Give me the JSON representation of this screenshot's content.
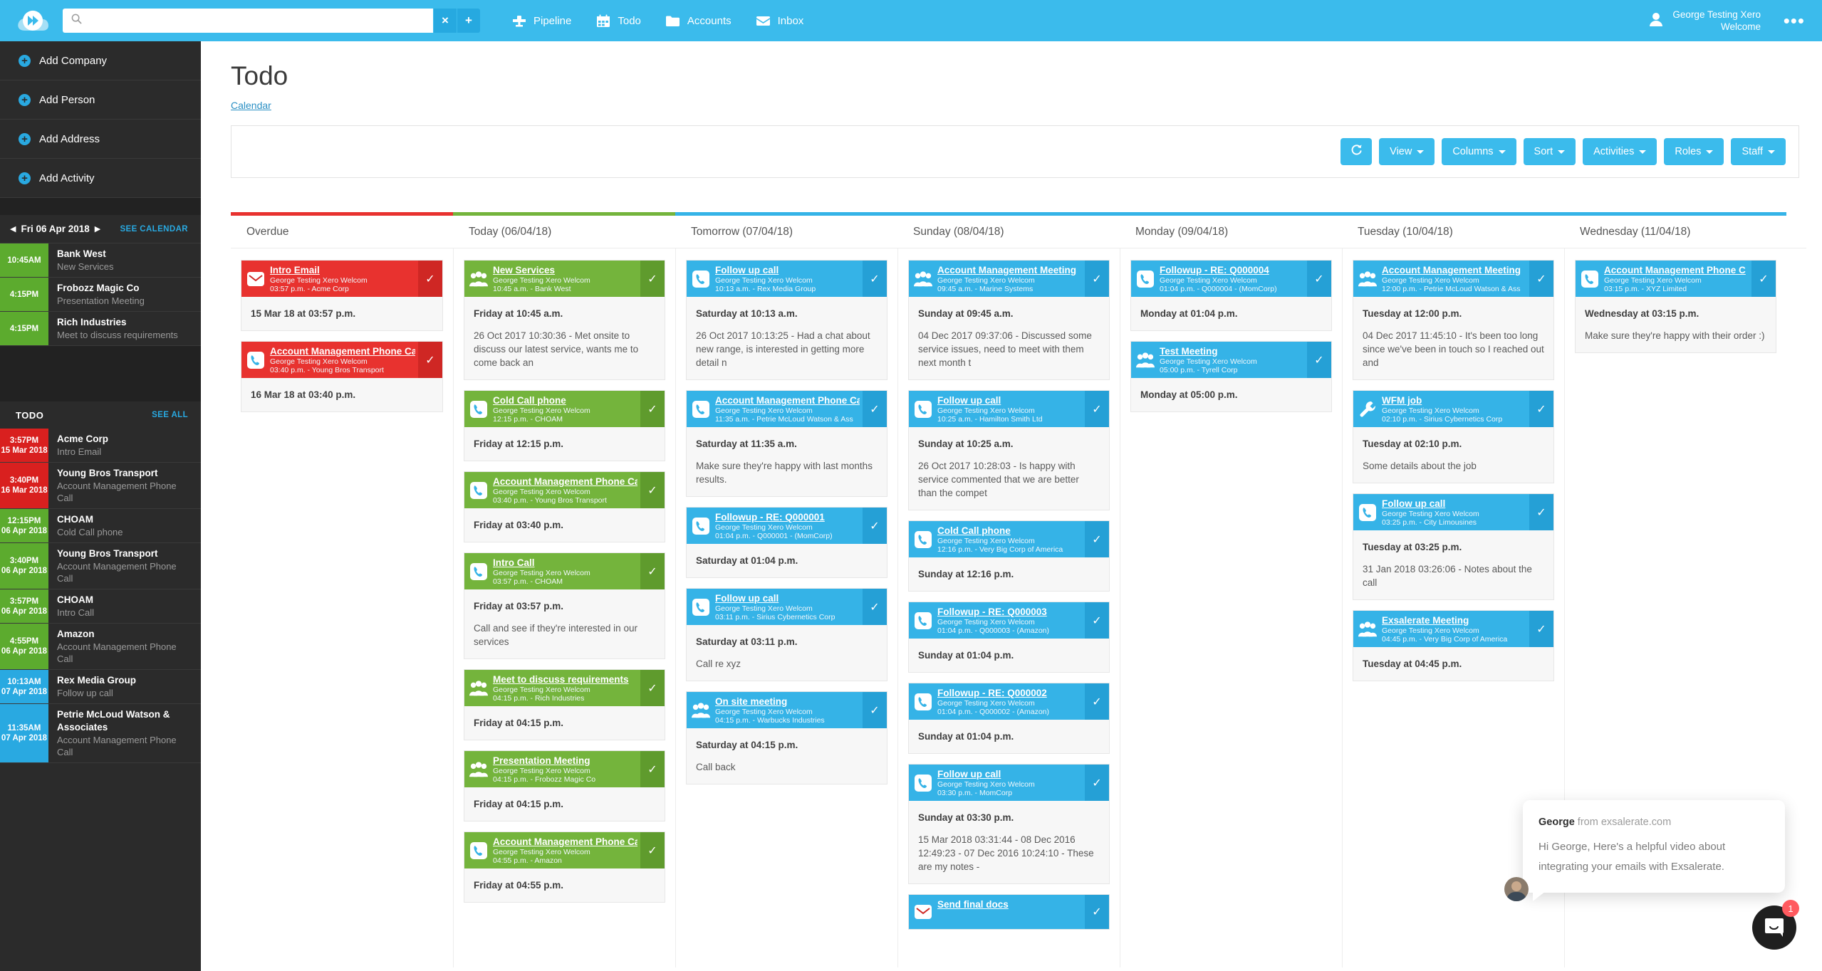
{
  "topbar": {
    "logo_icon": "cloud-fast-forward-logo",
    "search": {
      "value": "",
      "placeholder": "",
      "clear_label": "×",
      "add_label": "+"
    },
    "nav": [
      {
        "label": "Pipeline",
        "icon": "pipeline-icon"
      },
      {
        "label": "Todo",
        "icon": "calendar-icon"
      },
      {
        "label": "Accounts",
        "icon": "folder-icon"
      },
      {
        "label": "Inbox",
        "icon": "inbox-icon"
      }
    ],
    "user": {
      "line1": "George Testing Xero",
      "line2": "Welcome",
      "icon": "user-avatar-icon"
    },
    "more_label": "•••"
  },
  "sidebar": {
    "add_items": [
      {
        "label": "Add Company"
      },
      {
        "label": "Add Person"
      },
      {
        "label": "Add Address"
      },
      {
        "label": "Add Activity"
      }
    ],
    "daynav": {
      "prev": "◀",
      "date": "Fri 06 Apr 2018",
      "next": "▶",
      "see_calendar": "SEE CALENDAR"
    },
    "day_events": [
      {
        "time": "10:45AM",
        "color": "green",
        "title": "Bank West",
        "sub": "New Services"
      },
      {
        "time": "4:15PM",
        "color": "green",
        "title": "Frobozz Magic Co",
        "sub": "Presentation Meeting"
      },
      {
        "time": "4:15PM",
        "color": "green",
        "title": "Rich Industries",
        "sub": "Meet to discuss requirements"
      }
    ],
    "todo_header": {
      "title": "TODO",
      "see_all": "SEE ALL"
    },
    "todo_items": [
      {
        "time": "3:57PM",
        "date": "15 Mar 2018",
        "color": "red",
        "title": "Acme Corp",
        "sub": "Intro Email"
      },
      {
        "time": "3:40PM",
        "date": "16 Mar 2018",
        "color": "red",
        "title": "Young Bros Transport",
        "sub": "Account Management Phone Call"
      },
      {
        "time": "12:15PM",
        "date": "06 Apr 2018",
        "color": "green",
        "title": "CHOAM",
        "sub": "Cold Call phone"
      },
      {
        "time": "3:40PM",
        "date": "06 Apr 2018",
        "color": "green",
        "title": "Young Bros Transport",
        "sub": "Account Management Phone Call"
      },
      {
        "time": "3:57PM",
        "date": "06 Apr 2018",
        "color": "green",
        "title": "CHOAM",
        "sub": "Intro Call"
      },
      {
        "time": "4:55PM",
        "date": "06 Apr 2018",
        "color": "green",
        "title": "Amazon",
        "sub": "Account Management Phone Call"
      },
      {
        "time": "10:13AM",
        "date": "07 Apr 2018",
        "color": "blue",
        "title": "Rex Media Group",
        "sub": "Follow up call"
      },
      {
        "time": "11:35AM",
        "date": "07 Apr 2018",
        "color": "blue",
        "title": "Petrie McLoud Watson & Associates",
        "sub": "Account Management Phone Call"
      }
    ]
  },
  "main": {
    "page_title": "Todo",
    "calendar_link": "Calendar",
    "toolbar": [
      {
        "label": "",
        "icon": "refresh-icon",
        "icononly": true,
        "name": "refresh-button"
      },
      {
        "label": "View",
        "caret": true,
        "name": "view-dropdown"
      },
      {
        "label": "Columns",
        "caret": true,
        "name": "columns-dropdown"
      },
      {
        "label": "Sort",
        "caret": true,
        "name": "sort-dropdown"
      },
      {
        "label": "Activities",
        "caret": true,
        "name": "activities-dropdown"
      },
      {
        "label": "Roles",
        "caret": true,
        "name": "roles-dropdown"
      },
      {
        "label": "Staff",
        "caret": true,
        "name": "staff-dropdown"
      }
    ],
    "columns": [
      {
        "header": "Overdue",
        "strip": "#e8322f",
        "color": "red",
        "cards": [
          {
            "icon": "email-icon",
            "title": "Intro Email",
            "owner": "George Testing Xero Welcom",
            "meta": "03:57 p.m. - Acme Corp",
            "when": "15 Mar 18 at 03:57 p.m.",
            "note": ""
          },
          {
            "icon": "phone-icon",
            "title": "Account Management Phone Ca",
            "owner": "George Testing Xero Welcom",
            "meta": "03:40 p.m. - Young Bros Transport",
            "when": "16 Mar 18 at 03:40 p.m.",
            "note": ""
          }
        ]
      },
      {
        "header": "Today (06/04/18)",
        "strip": "#74b43c",
        "color": "green",
        "cards": [
          {
            "icon": "meeting-icon",
            "title": "New Services",
            "owner": "George Testing Xero Welcom",
            "meta": "10:45 a.m. - Bank West",
            "when": "Friday at 10:45 a.m.",
            "note": "26 Oct 2017 10:30:36 - Met onsite to discuss our latest service, wants me to come back an"
          },
          {
            "icon": "phone-icon",
            "title": "Cold Call phone",
            "owner": "George Testing Xero Welcom",
            "meta": "12:15 p.m. - CHOAM",
            "when": "Friday at 12:15 p.m.",
            "note": ""
          },
          {
            "icon": "phone-icon",
            "title": "Account Management Phone Ca",
            "owner": "George Testing Xero Welcom",
            "meta": "03:40 p.m. - Young Bros Transport",
            "when": "Friday at 03:40 p.m.",
            "note": ""
          },
          {
            "icon": "phone-icon",
            "title": "Intro Call",
            "owner": "George Testing Xero Welcom",
            "meta": "03:57 p.m. - CHOAM",
            "when": "Friday at 03:57 p.m.",
            "note": "Call and see if they're interested in our services"
          },
          {
            "icon": "meeting-icon",
            "title": "Meet to discuss requirements",
            "owner": "George Testing Xero Welcom",
            "meta": "04:15 p.m. - Rich Industries",
            "when": "Friday at 04:15 p.m.",
            "note": ""
          },
          {
            "icon": "meeting-icon",
            "title": "Presentation Meeting",
            "owner": "George Testing Xero Welcom",
            "meta": "04:15 p.m. - Frobozz Magic Co",
            "when": "Friday at 04:15 p.m.",
            "note": ""
          },
          {
            "icon": "phone-icon",
            "title": "Account Management Phone Ca",
            "owner": "George Testing Xero Welcom",
            "meta": "04:55 p.m. - Amazon",
            "when": "Friday at 04:55 p.m.",
            "note": ""
          }
        ]
      },
      {
        "header": "Tomorrow (07/04/18)",
        "strip": "#35b3e7",
        "color": "blue",
        "cards": [
          {
            "icon": "phone-icon",
            "title": "Follow up call",
            "owner": "George Testing Xero Welcom",
            "meta": "10:13 a.m. - Rex Media Group",
            "when": "Saturday at 10:13 a.m.",
            "note": "26 Oct 2017 10:13:25 - Had a chat about new range, is interested in getting more detail n"
          },
          {
            "icon": "phone-icon",
            "title": "Account Management Phone Ca",
            "owner": "George Testing Xero Welcom",
            "meta": "11:35 a.m. - Petrie McLoud Watson & Ass",
            "when": "Saturday at 11:35 a.m.",
            "note": "Make sure they're happy with last months results."
          },
          {
            "icon": "phone-icon",
            "title": "Followup - RE: Q000001",
            "owner": "George Testing Xero Welcom",
            "meta": "01:04 p.m. - Q000001 - (MomCorp)",
            "when": "Saturday at 01:04 p.m.",
            "note": ""
          },
          {
            "icon": "phone-icon",
            "title": "Follow up call",
            "owner": "George Testing Xero Welcom",
            "meta": "03:11 p.m. - Sirius Cybernetics Corp",
            "when": "Saturday at 03:11 p.m.",
            "note": "Call re xyz"
          },
          {
            "icon": "meeting-icon",
            "title": "On site meeting",
            "owner": "George Testing Xero Welcom",
            "meta": "04:15 p.m. - Warbucks Industries",
            "when": "Saturday at 04:15 p.m.",
            "note": "Call back"
          }
        ]
      },
      {
        "header": "Sunday (08/04/18)",
        "strip": "#35b3e7",
        "color": "blue",
        "cards": [
          {
            "icon": "meeting-icon",
            "title": "Account Management Meeting",
            "owner": "George Testing Xero Welcom",
            "meta": "09:45 a.m. - Marine Systems",
            "when": "Sunday at 09:45 a.m.",
            "note": "04 Dec 2017 09:37:06 - Discussed some service issues, need to meet with them next month t"
          },
          {
            "icon": "phone-icon",
            "title": "Follow up call",
            "owner": "George Testing Xero Welcom",
            "meta": "10:25 a.m. - Hamilton Smith Ltd",
            "when": "Sunday at 10:25 a.m.",
            "note": "26 Oct 2017 10:28:03 - Is happy with service commented that we are better than the compet"
          },
          {
            "icon": "phone-icon",
            "title": "Cold Call phone",
            "owner": "George Testing Xero Welcom",
            "meta": "12:16 p.m. - Very Big Corp of America",
            "when": "Sunday at 12:16 p.m.",
            "note": ""
          },
          {
            "icon": "phone-icon",
            "title": "Followup - RE: Q000003",
            "owner": "George Testing Xero Welcom",
            "meta": "01:04 p.m. - Q000003 - (Amazon)",
            "when": "Sunday at 01:04 p.m.",
            "note": ""
          },
          {
            "icon": "phone-icon",
            "title": "Followup - RE: Q000002",
            "owner": "George Testing Xero Welcom",
            "meta": "01:04 p.m. - Q000002 - (Amazon)",
            "when": "Sunday at 01:04 p.m.",
            "note": ""
          },
          {
            "icon": "phone-icon",
            "title": "Follow up call",
            "owner": "George Testing Xero Welcom",
            "meta": "03:30 p.m. - MomCorp",
            "when": "Sunday at 03:30 p.m.",
            "note": "15 Mar 2018 03:31:44 - 08 Dec 2016 12:49:23 - 07 Dec 2016 10:24:10 - These are my notes -"
          },
          {
            "icon": "email-icon",
            "title": "Send final docs",
            "owner": "",
            "meta": "",
            "when": "",
            "note": ""
          }
        ]
      },
      {
        "header": "Monday (09/04/18)",
        "strip": "#35b3e7",
        "color": "blue",
        "cards": [
          {
            "icon": "phone-icon",
            "title": "Followup - RE: Q000004",
            "owner": "George Testing Xero Welcom",
            "meta": "01:04 p.m. - Q000004 - (MomCorp)",
            "when": "Monday at 01:04 p.m.",
            "note": ""
          },
          {
            "icon": "meeting-icon",
            "title": "Test Meeting",
            "owner": "George Testing Xero Welcom",
            "meta": "05:00 p.m. - Tyrell Corp",
            "when": "Monday at 05:00 p.m.",
            "note": ""
          }
        ]
      },
      {
        "header": "Tuesday (10/04/18)",
        "strip": "#35b3e7",
        "color": "blue",
        "cards": [
          {
            "icon": "meeting-icon",
            "title": "Account Management Meeting",
            "owner": "George Testing Xero Welcom",
            "meta": "12:00 p.m. - Petrie McLoud Watson & Ass",
            "when": "Tuesday at 12:00 p.m.",
            "note": "04 Dec 2017 11:45:10 - It's been too long since we've been in touch so I reached out and"
          },
          {
            "icon": "wrench-icon",
            "title": "WFM job",
            "owner": "George Testing Xero Welcom",
            "meta": "02:10 p.m. - Sirius Cybernetics Corp",
            "when": "Tuesday at 02:10 p.m.",
            "note": "Some details about the job"
          },
          {
            "icon": "phone-icon",
            "title": "Follow up call",
            "owner": "George Testing Xero Welcom",
            "meta": "03:25 p.m. - City Limousines",
            "when": "Tuesday at 03:25 p.m.",
            "note": "31 Jan 2018 03:26:06 - Notes about the call"
          },
          {
            "icon": "meeting-icon",
            "title": "Exsalerate Meeting",
            "owner": "George Testing Xero Welcom",
            "meta": "04:45 p.m. - Very Big Corp of America",
            "when": "Tuesday at 04:45 p.m.",
            "note": ""
          }
        ]
      },
      {
        "header": "Wednesday (11/04/18)",
        "strip": "#35b3e7",
        "color": "blue",
        "cards": [
          {
            "icon": "phone-icon",
            "title": "Account Management Phone C",
            "owner": "George Testing Xero Welcom",
            "meta": "03:15 p.m. - XYZ Limited",
            "when": "Wednesday at 03:15 p.m.",
            "note": "Make sure they're happy with their order :)"
          }
        ]
      }
    ]
  },
  "chat": {
    "author": "George",
    "author_suffix": " from exsalerate.com",
    "message": "Hi George, Here's a helpful video about integrating your emails with Exsalerate.",
    "badge": "1"
  }
}
